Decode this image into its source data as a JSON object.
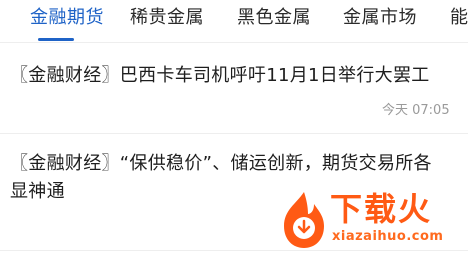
{
  "tabs": [
    {
      "label": "金融期货",
      "active": true
    },
    {
      "label": "稀贵金属",
      "active": false
    },
    {
      "label": "黑色金属",
      "active": false
    },
    {
      "label": "金属市场",
      "active": false
    },
    {
      "label": "能",
      "active": false
    }
  ],
  "news": [
    {
      "title": "〖金融财经〗巴西卡车司机呼吁11月1日举行大罢工",
      "time": "今天 07:05"
    },
    {
      "title": "〖金融财经〗“保供稳价”、储运创新，期货交易所各显神通"
    }
  ],
  "watermark": {
    "brand_text": "下载火",
    "url": "xiazaihuo.com",
    "icon": "flame-download-icon"
  },
  "colors": {
    "accent": "#1f63c7",
    "watermark": "#ff5a14"
  }
}
